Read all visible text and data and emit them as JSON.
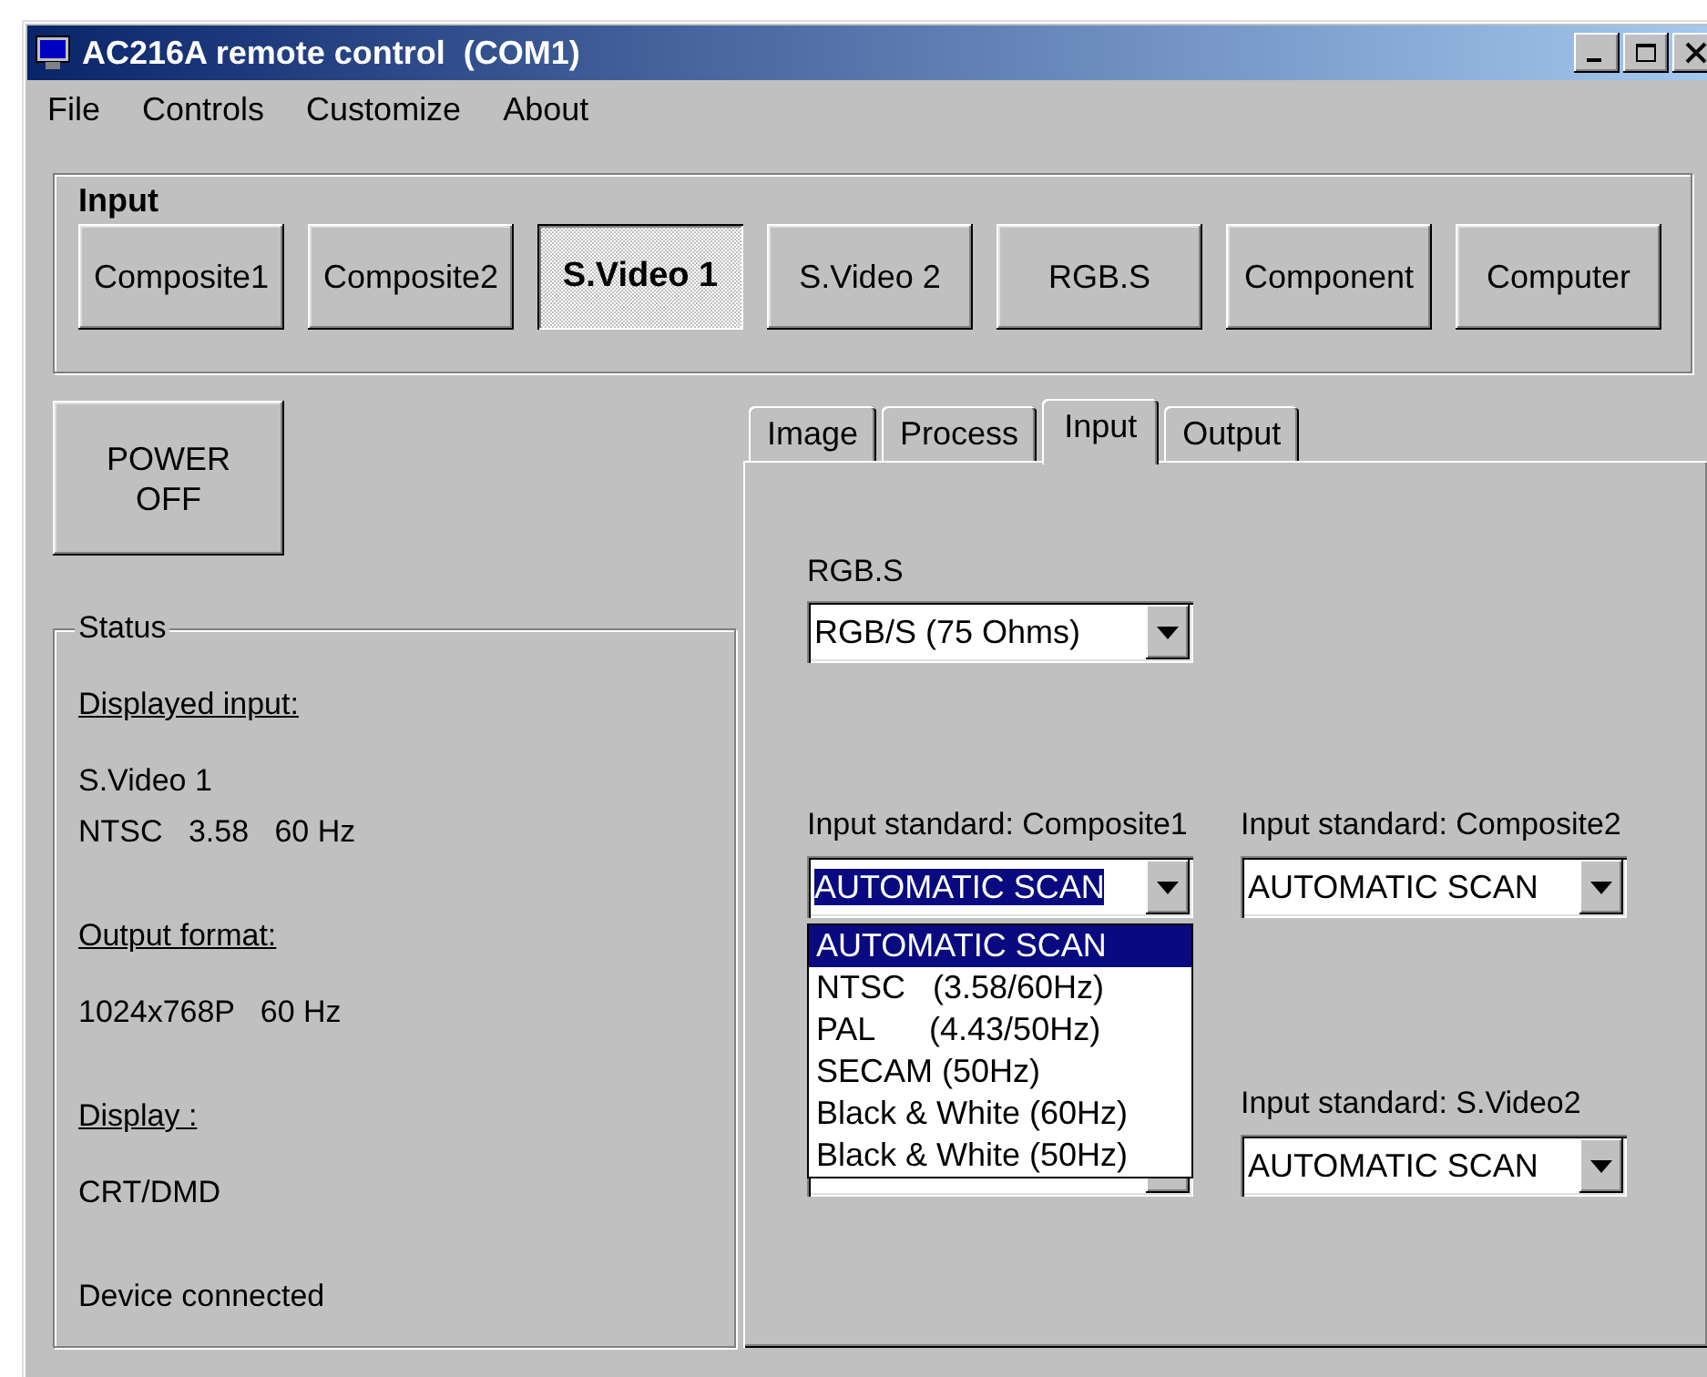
{
  "window": {
    "title": "AC216A remote control  (COM1)"
  },
  "menu": [
    "File",
    "Controls",
    "Customize",
    "About"
  ],
  "input_group": {
    "title": "Input",
    "buttons": [
      {
        "label": "Composite1",
        "selected": false
      },
      {
        "label": "Composite2",
        "selected": false
      },
      {
        "label": "S.Video 1",
        "selected": true
      },
      {
        "label": "S.Video 2",
        "selected": false
      },
      {
        "label": "RGB.S",
        "selected": false
      },
      {
        "label": "Component",
        "selected": false
      },
      {
        "label": "Computer",
        "selected": false
      }
    ]
  },
  "power_button": {
    "label_lines": [
      "POWER",
      "OFF"
    ]
  },
  "status": {
    "title": "Status",
    "sections": [
      {
        "heading": "Displayed input:",
        "lines": [
          "S.Video 1",
          "NTSC   3.58   60 Hz"
        ]
      },
      {
        "heading": "Output format:",
        "lines": [
          "1024x768P   60 Hz"
        ]
      },
      {
        "heading": "Display :",
        "lines": [
          "CRT/DMD"
        ]
      }
    ],
    "message": "Device connected"
  },
  "tabs": [
    {
      "label": "Image",
      "selected": false
    },
    {
      "label": "Process",
      "selected": false
    },
    {
      "label": "Input",
      "selected": true
    },
    {
      "label": "Output",
      "selected": false
    }
  ],
  "input_tab": {
    "rgbs": {
      "label": "RGB.S",
      "value": "RGB/S (75 Ohms)"
    },
    "standards": [
      {
        "kind": "dropdown",
        "label": "Input standard: Composite1",
        "value": "AUTOMATIC SCAN",
        "focused": true,
        "options": [
          {
            "label": "AUTOMATIC SCAN",
            "selected": true
          },
          {
            "label": "NTSC   (3.58/60Hz)",
            "selected": false
          },
          {
            "label": "PAL      (4.43/50Hz)",
            "selected": false
          },
          {
            "label": "SECAM (50Hz)",
            "selected": false
          },
          {
            "label": "Black & White (60Hz)",
            "selected": false
          },
          {
            "label": "Black & White (50Hz)",
            "selected": false
          }
        ]
      },
      {
        "kind": "dropdown",
        "label": "Input standard: Composite2",
        "value": "AUTOMATIC SCAN",
        "focused": false
      },
      {
        "kind": "covered"
      },
      {
        "kind": "dropdown",
        "label": "Input standard: S.Video2",
        "value": "AUTOMATIC SCAN",
        "focused": false
      }
    ]
  }
}
